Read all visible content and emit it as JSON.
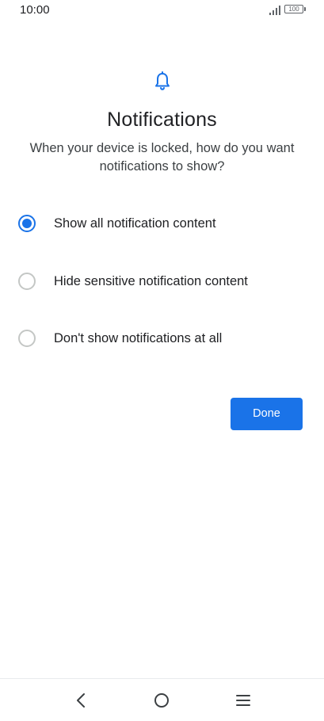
{
  "status_bar": {
    "time": "10:00",
    "battery": "100",
    "signal_icon": "signal-bars-icon"
  },
  "header": {
    "icon": "bell-icon",
    "title": "Notifications",
    "subtitle": "When your device is locked, how do you want notifications to show?"
  },
  "options": [
    {
      "label": "Show all notification content",
      "checked": true
    },
    {
      "label": "Hide sensitive notification content",
      "checked": false
    },
    {
      "label": "Don't show notifications at all",
      "checked": false
    }
  ],
  "actions": {
    "done_label": "Done"
  },
  "nav_bar": {
    "back_icon": "back-chevron-icon",
    "home_icon": "home-circle-icon",
    "menu_icon": "menu-lines-icon"
  },
  "colors": {
    "accent": "#1a73e8",
    "radio_unchecked": "#c4c7c5",
    "text_primary": "#202124"
  }
}
